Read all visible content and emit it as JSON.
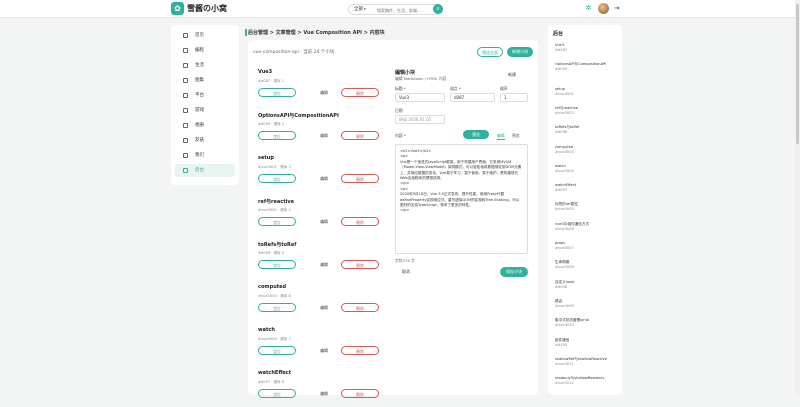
{
  "header": {
    "brand": "雪酱の小窝",
    "search_category": "全部",
    "search_placeholder": "搜索稿件、生活、前端..."
  },
  "sidebar": {
    "items": [
      {
        "label": "首页",
        "icon": "home-icon"
      },
      {
        "label": "编程",
        "icon": "code-icon"
      },
      {
        "label": "生活",
        "icon": "life-icon"
      },
      {
        "label": "图集",
        "icon": "gallery-icon"
      },
      {
        "label": "平台",
        "icon": "platform-icon"
      },
      {
        "label": "游戏",
        "icon": "game-icon"
      },
      {
        "label": "相册",
        "icon": "album-icon"
      },
      {
        "label": "友链",
        "icon": "link-icon"
      },
      {
        "label": "我们",
        "icon": "about-icon"
      },
      {
        "label": "后台",
        "icon": "admin-icon",
        "active": true
      }
    ]
  },
  "breadcrumb": "后台管理 > 文章管理 > Vue Composition API > 内容块",
  "main": {
    "title": "vue-composition-api · 当前 24 个小块",
    "btn_outline": "筛选全部",
    "btn_new": "新增小块"
  },
  "list": {
    "locate_label": "定位",
    "edit_label": "编辑",
    "delete_label": "删除",
    "items": [
      {
        "title": "Vue3",
        "meta": "#d087 · 顺序 1"
      },
      {
        "title": "OptionsAPI与CompositionAPI",
        "meta": "#d095 · 顺序 2"
      },
      {
        "title": "setup",
        "meta": "#vue3001 · 顺序 3"
      },
      {
        "title": "ref与reactive",
        "meta": "#vue3002 · 顺序 4"
      },
      {
        "title": "toRefs与toRef",
        "meta": "#d096 · 顺序 5"
      },
      {
        "title": "computed",
        "meta": "#vue3003 · 顺序 6"
      },
      {
        "title": "watch",
        "meta": "#vue3004 · 顺序 7"
      },
      {
        "title": "watchEffect",
        "meta": "#d097 · 顺序 8"
      }
    ]
  },
  "editor": {
    "title": "编辑小块",
    "subtitle": "编辑 Markdown / HTML 内容",
    "new_label": "新建",
    "label_title": "标题 *",
    "label_id": "锚点 *",
    "label_order": "顺序",
    "value_title": "Vue3",
    "value_id": "d087",
    "value_order": "1",
    "label_date": "日期",
    "value_date": "例如 2026.01.05",
    "label_content": "内容 *",
    "preview_label": "预览",
    "tab_edit": "编辑",
    "tab_preview": "预览",
    "content": "<h2>Vue3</h2>\n<p>\nVue是一个渐进式JavaScript框架。用于构建用户界面。它采用MVVM（Model-View-ViewModel）架构模式。可以轻松地将数据绑定到DOM元素上，并响应数据的变化。Vue易于学习，易于使用，易于维护，是构建现代Web应用程序的理想选择。\n</p>\n<p>\n2020年9月18日，Vue 3.0正式发布。提升性能，使用Proxy代替defineProperty实现响应式，重写虚拟DOM的实现和Tree-Shaking，可以更好的支持TypeScript，带来了更多的特性。\n</p>",
    "char_count": "字符274 字",
    "btn_cancel": "取消",
    "btn_save": "保存小块"
  },
  "rightbar": {
    "title": "后台",
    "items": [
      {
        "name": "Vue3",
        "id": "#d087"
      },
      {
        "name": "OptionsAPI与CompositionAPI",
        "id": "#d095"
      },
      {
        "name": "setup",
        "id": "#vue3001"
      },
      {
        "name": "ref与reactive",
        "id": "#vue3002"
      },
      {
        "name": "toRefs与toRef",
        "id": "#d096"
      },
      {
        "name": "computed",
        "id": "#vue3003"
      },
      {
        "name": "watch",
        "id": "#vue3004"
      },
      {
        "name": "watchEffect",
        "id": "#d097"
      },
      {
        "name": "标签的ref属性",
        "id": "#vue3005"
      },
      {
        "name": "vue3中组件通信方式",
        "id": "#vue3006"
      },
      {
        "name": "props",
        "id": "#vue3007"
      },
      {
        "name": "生命周期",
        "id": "#vue3008"
      },
      {
        "name": "自定义hook",
        "id": "#d098"
      },
      {
        "name": "路由",
        "id": "#vue3009"
      },
      {
        "name": "集中式状态管理pinia",
        "id": "#vue3010"
      },
      {
        "name": "组件通信",
        "id": "#d100"
      },
      {
        "name": "shallowRef与shallowReactive",
        "id": "#vue3011"
      },
      {
        "name": "readonly与shallowReadonly",
        "id": "#vue3012"
      }
    ]
  },
  "colors": {
    "accent": "#2fb29b",
    "danger": "#e05555"
  }
}
